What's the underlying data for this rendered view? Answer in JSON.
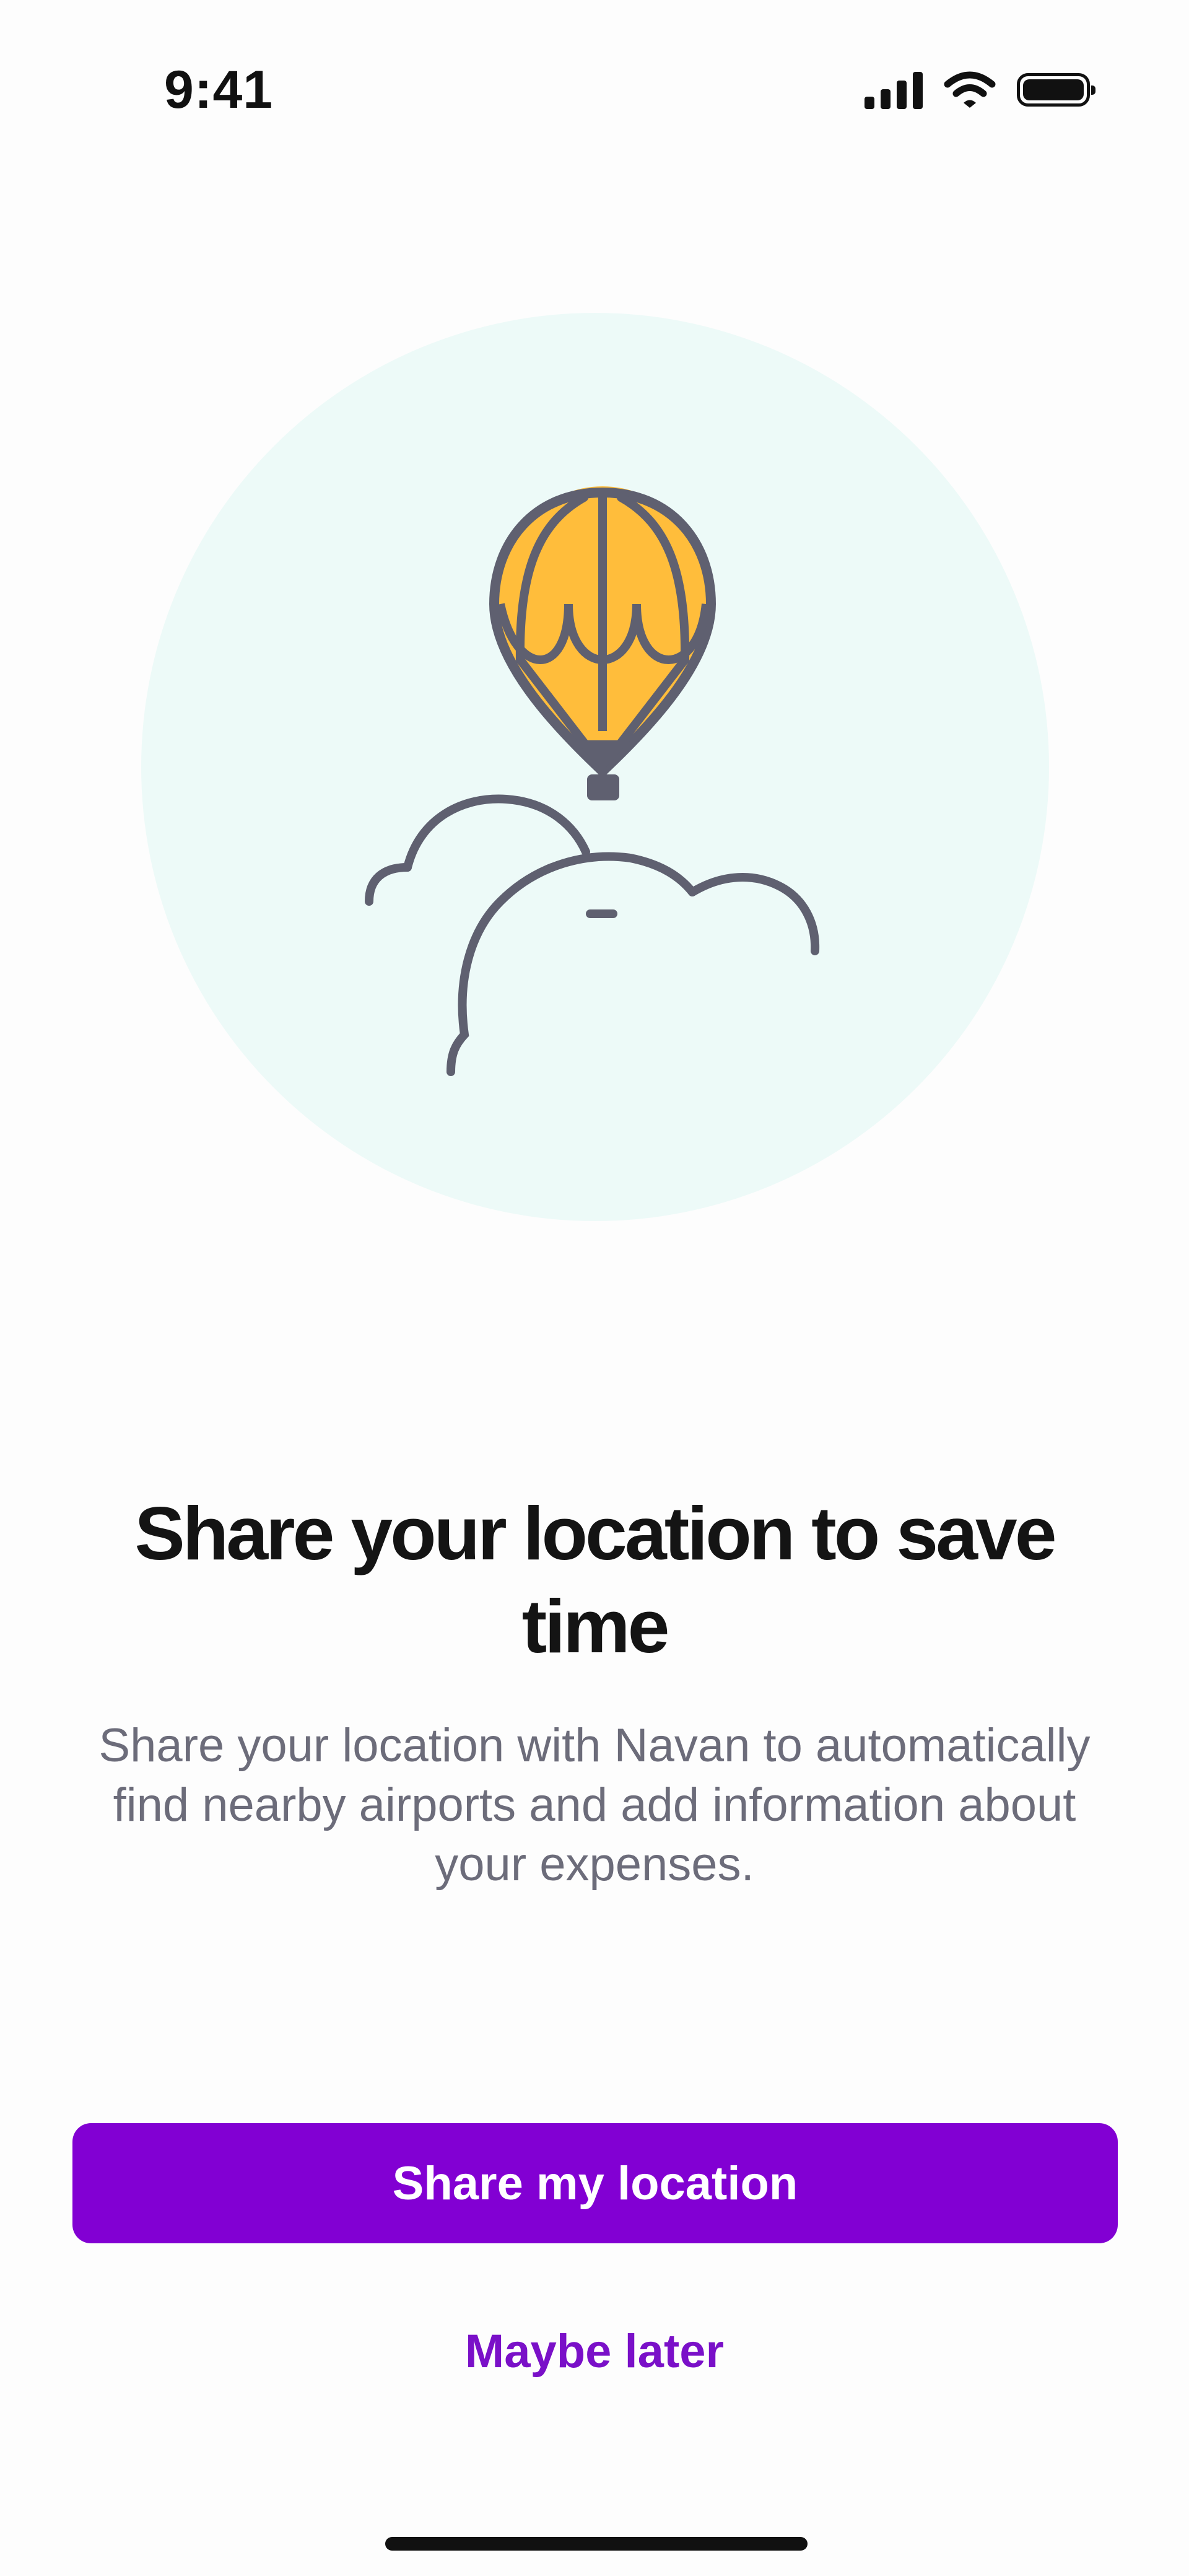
{
  "status_bar": {
    "time": "9:41",
    "icons": [
      "cellular-signal-icon",
      "wifi-icon",
      "battery-icon"
    ]
  },
  "illustration": {
    "subject": "hot-air-balloon-icon",
    "colors": {
      "circle_background": "#edfaf8",
      "balloon_fill": "#ffbd3b",
      "outline": "#5f6070"
    }
  },
  "content": {
    "title": "Share your location to save time",
    "description": "Share your location with Navan to automatically find nearby airports and add information about your expenses."
  },
  "actions": {
    "primary_label": "Share my location",
    "secondary_label": "Maybe later"
  },
  "colors": {
    "accent": "#8200d3",
    "link": "#7a10c8",
    "title": "#141414",
    "body": "#6c6c7a"
  }
}
